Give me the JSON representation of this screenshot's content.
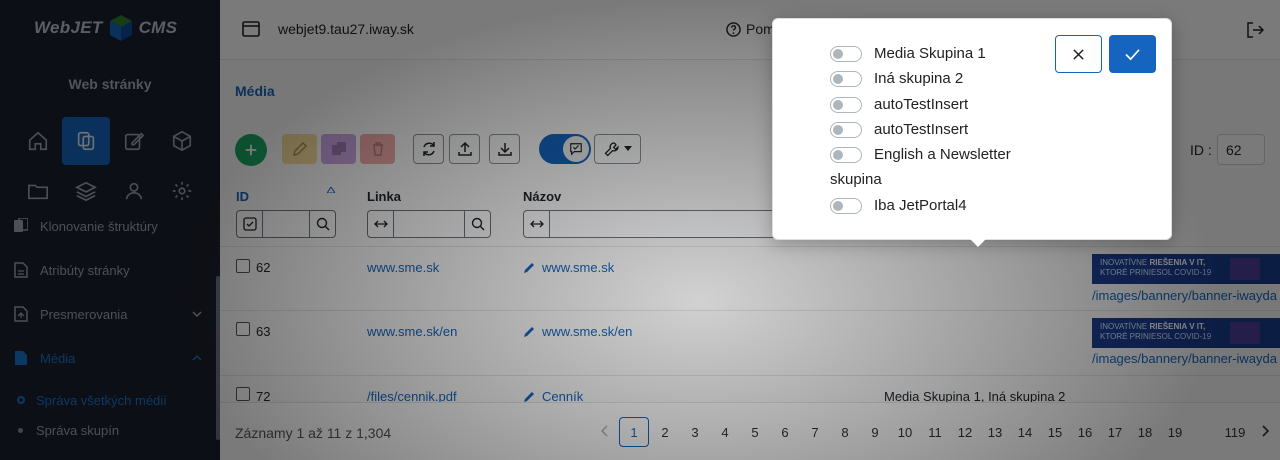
{
  "app": {
    "logo_left": "WebJET",
    "logo_right": "CMS",
    "section_title": "Web stránky",
    "domain": "webjet9.tau27.iway.sk",
    "help_label": "Pom",
    "colors": {
      "accent": "#1565c0",
      "sidebar": "#1a1f2b",
      "add": "#1aa865"
    }
  },
  "sidebar": {
    "icons_row1": [
      "home-icon",
      "copy-icon",
      "edit-icon",
      "cube-icon"
    ],
    "icons_row2": [
      "folder-icon",
      "layers-icon",
      "user-icon",
      "gear-icon"
    ],
    "items": [
      {
        "label": "Klonovanie štruktúry",
        "icon": "clone-icon"
      },
      {
        "label": "Atribúty stránky",
        "icon": "document-icon"
      },
      {
        "label": "Presmerovania",
        "icon": "redirect-icon"
      },
      {
        "label": "Média",
        "icon": "media-icon"
      }
    ],
    "subitems": [
      {
        "label": "Správa všetkých médií"
      },
      {
        "label": "Správa skupín"
      }
    ]
  },
  "page": {
    "title": "Média"
  },
  "toolbar": {
    "id_label": "ID :",
    "id_value": "62"
  },
  "table": {
    "headers": {
      "id": "ID",
      "link": "Linka",
      "name": "Názov"
    },
    "rows": [
      {
        "id": "62",
        "link": "www.sme.sk",
        "name": "www.sme.sk",
        "groups": "",
        "image": "/images/bannery/banner-iwayda"
      },
      {
        "id": "63",
        "link": "www.sme.sk/en",
        "name": "www.sme.sk/en",
        "groups": "",
        "image": "/images/bannery/banner-iwayda"
      },
      {
        "id": "72",
        "link": "/files/cennik.pdf",
        "name": "Cenník",
        "groups": "Media Skupina 1, Iná skupina 2",
        "image": ""
      }
    ],
    "banner_text_1": "INOVATÍVNE",
    "banner_text_2": "RIEŠENIA V IT,",
    "banner_text_3": "KTORÉ PRINIESOL COVID-19"
  },
  "footer": {
    "records": "Záznamy 1 až 11 z 1,304",
    "pages": [
      "1",
      "2",
      "3",
      "4",
      "5",
      "6",
      "7",
      "8",
      "9",
      "10",
      "11",
      "12",
      "13",
      "14",
      "15",
      "16",
      "17",
      "18",
      "19"
    ],
    "last_page": "119",
    "current_page": "1"
  },
  "popover": {
    "options": [
      {
        "label": "Media Skupina 1",
        "checked": false
      },
      {
        "label": "Iná skupina 2",
        "checked": false
      },
      {
        "label": "autoTestInsert",
        "checked": false
      },
      {
        "label": "autoTestInsert",
        "checked": false
      },
      {
        "label": "English a Newsletter",
        "label_cont": "skupina",
        "checked": false
      },
      {
        "label": "Iba JetPortal4",
        "checked": false
      }
    ]
  }
}
